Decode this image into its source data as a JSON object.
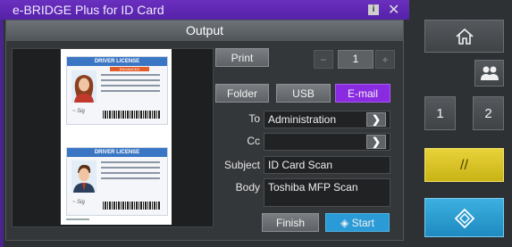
{
  "app": {
    "title": "e-BRIDGE Plus for ID Card",
    "info_icon": "info-icon",
    "close_glyph": "✕"
  },
  "dialog": {
    "title": "Output"
  },
  "preview": {
    "card_header": "DRIVER LICENSE",
    "card_subheader": "ENHANCED",
    "card_number": "ID: 123456789-001",
    "card_name": "NAME SURNAME",
    "card_date": "12.03.2017"
  },
  "print": {
    "label": "Print",
    "copies": "1",
    "minus": "−",
    "plus": "+"
  },
  "destinations": {
    "folder": "Folder",
    "usb": "USB",
    "email": "E-mail"
  },
  "fields": {
    "to_label": "To",
    "to_value": "Administration",
    "cc_label": "Cc",
    "cc_value": "",
    "subject_label": "Subject",
    "subject_value": "ID Card Scan",
    "body_label": "Body",
    "body_value": "Toshiba MFP Scan"
  },
  "actions": {
    "finish": "Finish",
    "start": "Start"
  },
  "right_panel": {
    "one": "1",
    "two": "2",
    "clear": "//"
  },
  "colors": {
    "accent_purple": "#8a2be2",
    "start_blue": "#2a9bd6",
    "clear_yellow": "#e0c92e"
  }
}
